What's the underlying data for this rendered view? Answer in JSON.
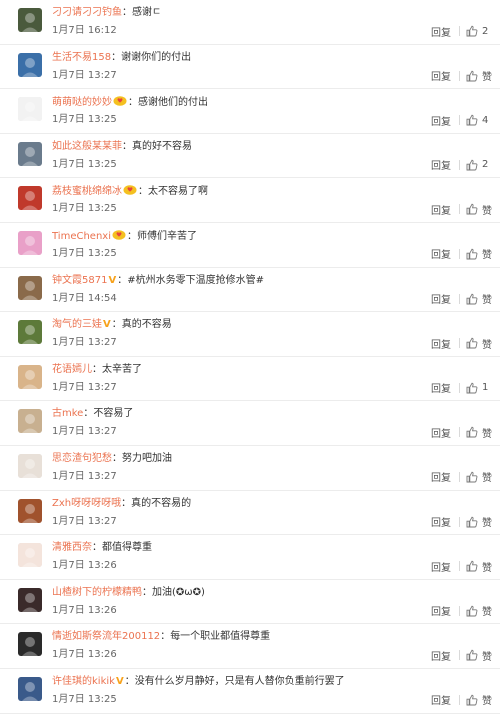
{
  "labels": {
    "reply": "回复"
  },
  "colors": {
    "username": "#eb7350",
    "text": "#333333",
    "meta": "#666666",
    "divider": "#ececec",
    "vip": "#f7a21b"
  },
  "comments": [
    {
      "user": "刁刁请刁刁钓鱼",
      "badge": "",
      "text": "感谢ㄷ",
      "time": "1月7日 16:12",
      "likes": "2",
      "avatar_color": "#4a5a3c"
    },
    {
      "user": "生活不易158",
      "badge": "",
      "text": "谢谢你们的付出",
      "time": "1月7日 13:27",
      "likes": "赞",
      "avatar_color": "#3b6fa8"
    },
    {
      "user": "萌萌哒的妙妙",
      "badge": "fan",
      "text": "感谢他们的付出",
      "time": "1月7日 13:25",
      "likes": "4",
      "avatar_color": "#f2f2f2"
    },
    {
      "user": "如此这般某某菲",
      "badge": "",
      "text": "真的好不容易",
      "time": "1月7日 13:25",
      "likes": "2",
      "avatar_color": "#6a7b8c"
    },
    {
      "user": "荔枝蜜桃绵绵冰",
      "badge": "fan",
      "text": "太不容易了啊",
      "time": "1月7日 13:25",
      "likes": "赞",
      "avatar_color": "#c0392b"
    },
    {
      "user": "TimeChenxi",
      "badge": "fan",
      "text": "师傅们辛苦了",
      "time": "1月7日 13:25",
      "likes": "赞",
      "avatar_color": "#e9a0c8"
    },
    {
      "user": "钟文霞5871",
      "badge": "v",
      "text": "#杭州水务零下温度抢修水管#",
      "time": "1月7日 14:54",
      "likes": "赞",
      "avatar_color": "#8a6a4a"
    },
    {
      "user": "淘气的三娃",
      "badge": "v",
      "text": "真的不容易",
      "time": "1月7日 13:27",
      "likes": "赞",
      "avatar_color": "#5d7a3a"
    },
    {
      "user": "花语嫣儿",
      "badge": "",
      "text": "太辛苦了",
      "time": "1月7日 13:27",
      "likes": "1",
      "avatar_color": "#d9b48a"
    },
    {
      "user": "古mke",
      "badge": "",
      "text": "不容易了",
      "time": "1月7日 13:27",
      "likes": "赞",
      "avatar_color": "#c8b090"
    },
    {
      "user": "思恋渣句犯愁",
      "badge": "",
      "text": "努力吧加油",
      "time": "1月7日 13:27",
      "likes": "赞",
      "avatar_color": "#e8e0d8"
    },
    {
      "user": "Zxh呀呀呀呀哦",
      "badge": "",
      "text": "真的不容易的",
      "time": "1月7日 13:27",
      "likes": "赞",
      "avatar_color": "#a0522d"
    },
    {
      "user": "清雅西奈",
      "badge": "",
      "text": "都值得尊重",
      "time": "1月7日 13:26",
      "likes": "赞",
      "avatar_color": "#f4e4dc"
    },
    {
      "user": "山楂树下的柠檬精鸭",
      "badge": "",
      "text": "加油(✪ω✪)",
      "time": "1月7日 13:26",
      "likes": "赞",
      "avatar_color": "#3a2a2a"
    },
    {
      "user": "情逝如斯祭流年200112",
      "badge": "",
      "text": "每一个职业都值得尊重",
      "time": "1月7日 13:26",
      "likes": "赞",
      "avatar_color": "#2a2a2a"
    },
    {
      "user": "许佳琪的kikik",
      "badge": "v",
      "text": "没有什么岁月静好，只是有人替你负重前行罢了",
      "time": "1月7日 13:25",
      "likes": "赞",
      "avatar_color": "#3a5a8a"
    }
  ]
}
